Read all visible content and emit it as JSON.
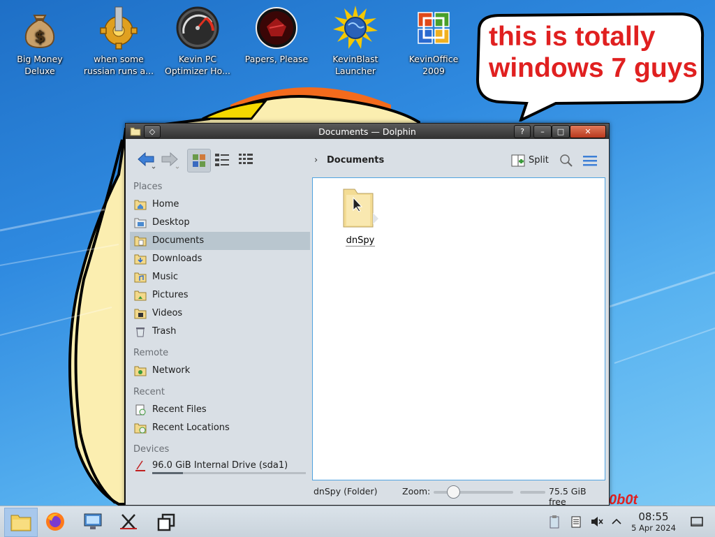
{
  "desktop": {
    "icons": [
      {
        "label_line1": "Big Money",
        "label_line2": "Deluxe",
        "icon": "money-bag-icon"
      },
      {
        "label_line1": "when some",
        "label_line2": "russian runs a...",
        "icon": "gear-icon"
      },
      {
        "label_line1": "Kevin PC",
        "label_line2": "Optimizer Ho...",
        "icon": "speedometer-icon"
      },
      {
        "label_line1": "Papers, Please",
        "label_line2": "",
        "icon": "papers-please-icon"
      },
      {
        "label_line1": "KevinBlast",
        "label_line2": "Launcher",
        "icon": "globe-icon"
      },
      {
        "label_line1": "KevinOffice",
        "label_line2": "2009",
        "icon": "office-logo-icon"
      }
    ],
    "speech_line1": "this is totally",
    "speech_line2": "windows 7 guys",
    "wallpaper_signature": "0b0t"
  },
  "window": {
    "title": "Documents — Dolphin",
    "titlebar_buttons": [
      "?",
      "–",
      "□",
      "✕"
    ],
    "breadcrumb": "Documents",
    "split_label": "Split",
    "places": {
      "places_title": "Places",
      "items": [
        {
          "label": "Home",
          "icon": "home-folder-icon"
        },
        {
          "label": "Desktop",
          "icon": "desktop-folder-icon"
        },
        {
          "label": "Documents",
          "icon": "documents-folder-icon",
          "selected": true
        },
        {
          "label": "Downloads",
          "icon": "downloads-folder-icon"
        },
        {
          "label": "Music",
          "icon": "music-folder-icon"
        },
        {
          "label": "Pictures",
          "icon": "pictures-folder-icon"
        },
        {
          "label": "Videos",
          "icon": "videos-folder-icon"
        },
        {
          "label": "Trash",
          "icon": "trash-icon"
        }
      ],
      "remote_title": "Remote",
      "remote_items": [
        {
          "label": "Network",
          "icon": "network-folder-icon"
        }
      ],
      "recent_title": "Recent",
      "recent_items": [
        {
          "label": "Recent Files",
          "icon": "recent-files-icon"
        },
        {
          "label": "Recent Locations",
          "icon": "recent-locations-icon"
        }
      ],
      "devices_title": "Devices",
      "devices_items": [
        {
          "label": "96.0 GiB Internal Drive (sda1)",
          "icon": "drive-icon",
          "usage_fraction": 0.2
        }
      ]
    },
    "files": [
      {
        "name": "dnSpy",
        "icon": "folder-icon"
      }
    ],
    "status": {
      "selection": "dnSpy (Folder)",
      "zoom_label": "Zoom:",
      "zoom_fraction": 0.2,
      "free_space": "75.5 GiB free"
    }
  },
  "taskbar": {
    "apps": [
      "file-manager-icon",
      "firefox-icon",
      "system-settings-icon",
      "x-app-icon",
      "window-switcher-icon"
    ],
    "clock_time": "08:55",
    "clock_date": "5 Apr 2024"
  },
  "colors": {
    "speech_text": "#e02020",
    "accent": "#3d7fd6",
    "selection": "#b9c6cf"
  }
}
